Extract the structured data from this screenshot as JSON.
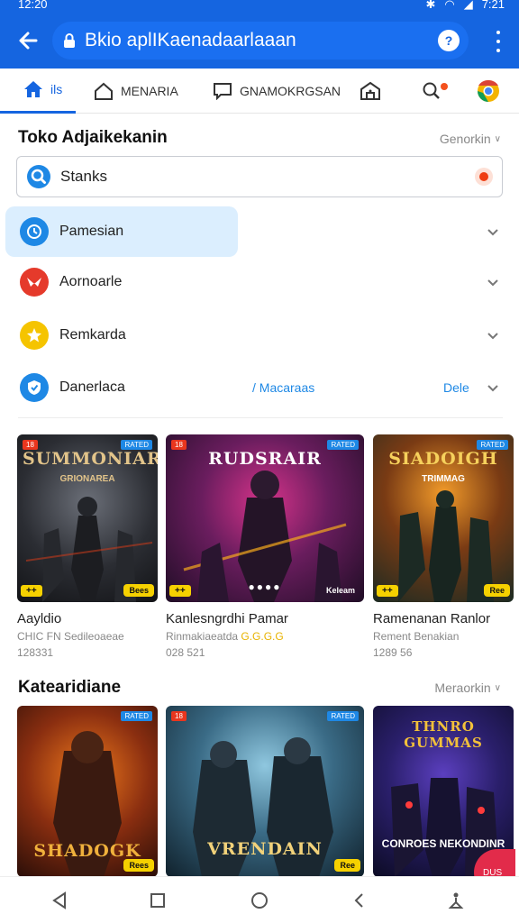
{
  "status": {
    "time": "12:20",
    "right_time": "7:21"
  },
  "browser": {
    "url": "Bkio aplIKaenadaarlaaan",
    "badge": "?"
  },
  "tabs": [
    {
      "label": "ils",
      "icon": "home-icon"
    },
    {
      "label": "MENARIA",
      "icon": "house-outline-icon"
    },
    {
      "label": "GNAMOKRGSAN",
      "icon": "chat-icon"
    },
    {
      "label": "",
      "icon": "store-icon"
    },
    {
      "label": "",
      "icon": "search-icon"
    },
    {
      "label": "",
      "icon": "browser-icon"
    }
  ],
  "store": {
    "title": "Toko Adjaikekanin",
    "more": "Genorkin"
  },
  "search": {
    "value": "Stanks"
  },
  "list": [
    {
      "label": "Pamesian",
      "icon": "clock-icon",
      "color": "#1e88e5",
      "highlighted": true
    },
    {
      "label": "Aornoarle",
      "icon": "mail-icon",
      "color": "#e53a2b",
      "highlighted": false
    },
    {
      "label": "Remkarda",
      "icon": "star-icon",
      "color": "#f5c400",
      "highlighted": false
    },
    {
      "label": "Danerlaca",
      "icon": "shield-icon",
      "color": "#1e88e5",
      "highlighted": false,
      "mid": "/ Macaraas",
      "end": "Dele"
    }
  ],
  "games": [
    {
      "art_title": "SUMMONIAR",
      "art_sub": "GRIONAREA",
      "tl": "18",
      "tr": "RATED",
      "bl": "++",
      "br": "Bees",
      "title": "Aayldio",
      "sub": "CHIC FN  Sedileoaeae",
      "num": "128331"
    },
    {
      "art_title": "RUDSRAIR",
      "art_sub": "",
      "tl": "18",
      "tr": "RATED",
      "bl": "++",
      "br": "Keleam",
      "title": "Kanlesngrdhi Pamar",
      "sub": "Rinmakiaeatda",
      "sub_hl": "G.G.G.G",
      "num": "028 521"
    },
    {
      "art_title": "SIADOIGH",
      "art_sub": "TRIMMAG",
      "tl": "",
      "tr": "RATED",
      "bl": "++",
      "br": "Ree",
      "title": "Ramenanan Ranlor",
      "sub": "Rement Benakian",
      "num": "1289 56"
    }
  ],
  "categories": {
    "title": "Katearidiane",
    "more": "Meraorkin"
  },
  "games2": [
    {
      "art_title": "SHADOGK",
      "art_sub": "",
      "tl": "",
      "tr": "RATED",
      "br": "Rees"
    },
    {
      "art_title": "VRENDAIN",
      "art_sub": "",
      "tl": "18",
      "tr": "RATED",
      "br": "Ree"
    },
    {
      "art_title": "THNRO GUMMAS",
      "art_sub": "",
      "tl": "",
      "tr": "",
      "br": "",
      "bottom": "CONROES NEKONDINR"
    }
  ],
  "fab": {
    "label": "DUS"
  }
}
